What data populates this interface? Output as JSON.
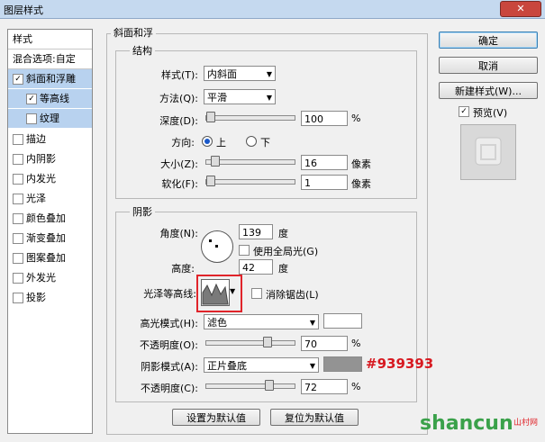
{
  "window": {
    "title": "图层样式",
    "close_label": "✕"
  },
  "left_panel": {
    "header": "样式",
    "blend": "混合选项:自定",
    "items": [
      {
        "label": "斜面和浮雕",
        "checked": true,
        "selected": true
      },
      {
        "label": "等高线",
        "checked": true,
        "selected": true
      },
      {
        "label": "纹理",
        "checked": false,
        "selected": true
      },
      {
        "label": "描边",
        "checked": false
      },
      {
        "label": "内阴影",
        "checked": false
      },
      {
        "label": "内发光",
        "checked": false
      },
      {
        "label": "光泽",
        "checked": false
      },
      {
        "label": "颜色叠加",
        "checked": false
      },
      {
        "label": "渐变叠加",
        "checked": false
      },
      {
        "label": "图案叠加",
        "checked": false
      },
      {
        "label": "外发光",
        "checked": false
      },
      {
        "label": "投影",
        "checked": false
      }
    ]
  },
  "bevel": {
    "group_title": "斜面和浮",
    "structure": {
      "title": "结构",
      "style_label": "样式(T):",
      "style_value": "内斜面",
      "method_label": "方法(Q):",
      "method_value": "平滑",
      "depth_label": "深度(D):",
      "depth_value": "100",
      "depth_unit": "%",
      "depth_fraction": 0.0,
      "direction_label": "方向:",
      "up_label": "上",
      "down_label": "下",
      "size_label": "大小(Z):",
      "size_value": "16",
      "size_unit": "像素",
      "size_fraction": 0.06,
      "soften_label": "软化(F):",
      "soften_value": "1",
      "soften_unit": "像素",
      "soften_fraction": 0.0
    },
    "shading": {
      "title": "阴影",
      "angle_label": "角度(N):",
      "angle_value": "139",
      "angle_unit": "度",
      "global_light_label": "使用全局光(G)",
      "altitude_label": "高度:",
      "altitude_value": "42",
      "altitude_unit": "度",
      "gloss_label": "光泽等高线:",
      "antialias_label": "消除锯齿(L)",
      "highlight_mode_label": "高光模式(H):",
      "highlight_mode_value": "滤色",
      "highlight_color": "#ffffff",
      "highlight_opacity_label": "不透明度(O):",
      "highlight_opacity_value": "70",
      "highlight_opacity_unit": "%",
      "highlight_fraction": 0.7,
      "shadow_mode_label": "阴影模式(A):",
      "shadow_mode_value": "正片叠底",
      "shadow_color": "#939393",
      "shadow_opacity_label": "不透明度(C):",
      "shadow_opacity_value": "72",
      "shadow_opacity_unit": "%",
      "shadow_fraction": 0.72
    },
    "make_default": "设置为默认值",
    "reset_default": "复位为默认值"
  },
  "right": {
    "ok": "确定",
    "cancel": "取消",
    "new_style": "新建样式(W)...",
    "preview_label": "预览(V)"
  },
  "annotation": {
    "hex": "#939393"
  },
  "watermark": {
    "main": "shancun",
    "sub": "山村网"
  }
}
